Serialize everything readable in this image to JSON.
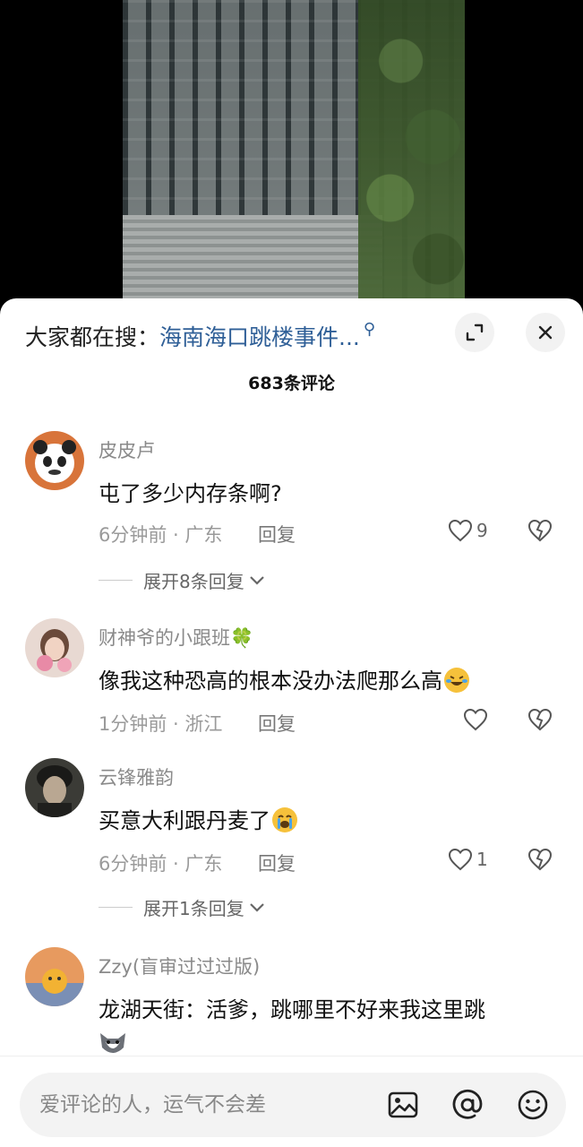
{
  "search": {
    "prefix": "大家都在搜：",
    "term": "海南海口跳楼事件...",
    "icon": "search-icon"
  },
  "sheet": {
    "count_title": "683条评论"
  },
  "comments": [
    {
      "username": "皮皮卢",
      "text": "屯了多少内存条啊?",
      "time_location": "6分钟前 · 广东",
      "reply_label": "回复",
      "likes": "9",
      "expand_label": "展开8条回复"
    },
    {
      "username": "财神爷的小跟班🍀",
      "text": "像我这种恐高的根本没办法爬那么高",
      "time_location": "1分钟前 · 浙江",
      "reply_label": "回复",
      "likes": ""
    },
    {
      "username": "云锋雅韵",
      "text": "买意大利跟丹麦了",
      "time_location": "6分钟前 · 广东",
      "reply_label": "回复",
      "likes": "1",
      "expand_label": "展开1条回复"
    },
    {
      "username": "Zzy(盲审过过过版)",
      "text": "龙湖天街：活爹，跳哪里不好来我这里跳"
    }
  ],
  "input": {
    "placeholder": "爱评论的人，运气不会差"
  },
  "colors": {
    "link_blue": "#2f5f97",
    "emoji_yellow": "#f6c13b"
  }
}
